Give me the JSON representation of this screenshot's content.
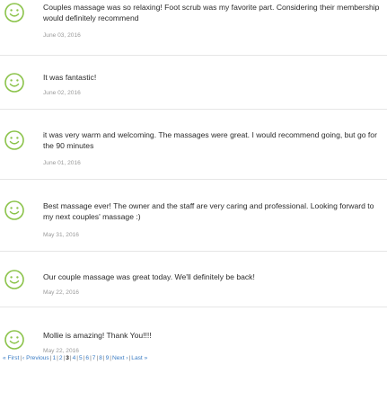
{
  "colors": {
    "smiley": "#8bc34a",
    "link": "#3a7cc4",
    "date": "#9a9a9a",
    "divider": "#e6e6e6"
  },
  "reviews": [
    {
      "icon": "smiley-face-icon",
      "text": "Couples massage was so relaxing! Foot scrub was my favorite part. Considering their membership would definitely recommend",
      "date": "June 03, 2016"
    },
    {
      "icon": "smiley-face-icon",
      "text": "It was fantastic!",
      "date": "June 02, 2016"
    },
    {
      "icon": "smiley-face-icon",
      "text": "it was very warm and welcoming. The massages were great. I would recommend going, but go for the 90 minutes",
      "date": "June 01, 2016"
    },
    {
      "icon": "smiley-face-icon",
      "text": "Best massage ever! The owner and the staff are very caring and professional. Looking forward to my next couples' massage :)",
      "date": "May 31, 2016"
    },
    {
      "icon": "smiley-face-icon",
      "text": "Our couple massage was great today. We'll definitely be back!",
      "date": "May 22, 2016"
    },
    {
      "icon": "smiley-face-icon",
      "text": "Mollie is amazing! Thank You!!!!",
      "date": "May 22, 2016"
    }
  ],
  "pagination": {
    "first": "« First",
    "previous": "‹ Previous",
    "pages": [
      "1",
      "2",
      "3",
      "4",
      "5",
      "6",
      "7",
      "8",
      "9"
    ],
    "current": "3",
    "next": "Next ›",
    "last": "Last »"
  }
}
